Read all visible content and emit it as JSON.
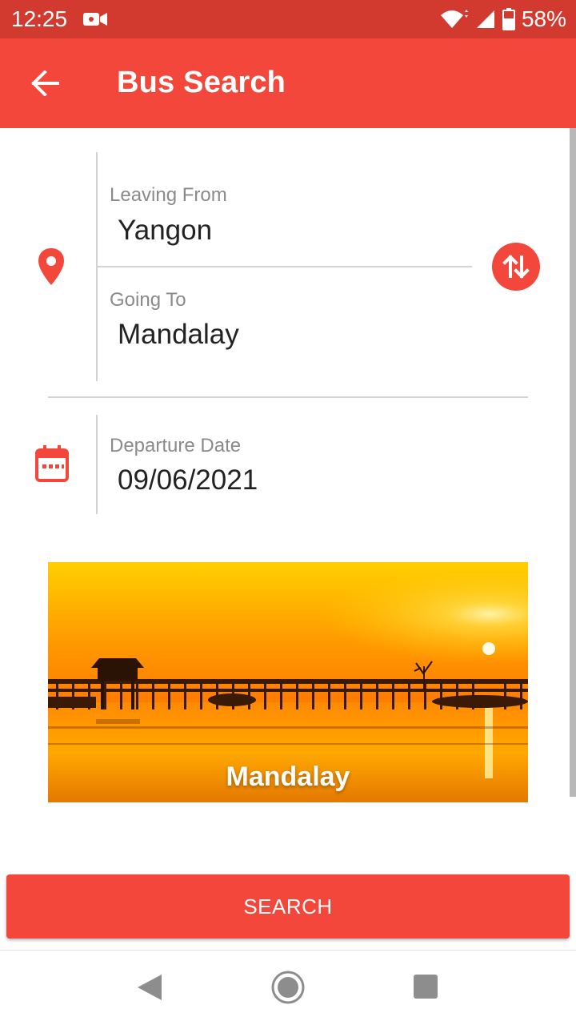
{
  "status_bar": {
    "time": "12:25",
    "battery_percent": "58%",
    "icons": [
      "video-camera-icon",
      "wifi-icon",
      "signal-icon",
      "battery-icon"
    ]
  },
  "app_bar": {
    "title": "Bus Search",
    "back_icon": "arrow-left-icon"
  },
  "form": {
    "leaving_from": {
      "label": "Leaving From",
      "value": "Yangon"
    },
    "going_to": {
      "label": "Going To",
      "value": "Mandalay"
    },
    "departure_date": {
      "label": "Departure Date",
      "value": "09/06/2021"
    },
    "location_icon": "map-pin-icon",
    "swap_icon": "swap-vertical-icon",
    "calendar_icon": "calendar-icon"
  },
  "destination_card": {
    "name": "Mandalay"
  },
  "search_button": {
    "label": "SEARCH"
  },
  "nav_bar": {
    "icons": [
      "nav-back-icon",
      "nav-home-icon",
      "nav-recent-icon"
    ]
  },
  "colors": {
    "primary": "#f3473b",
    "status_bar": "#d23a2f",
    "label_gray": "#8a8a8a",
    "divider": "#d2d2d2"
  }
}
